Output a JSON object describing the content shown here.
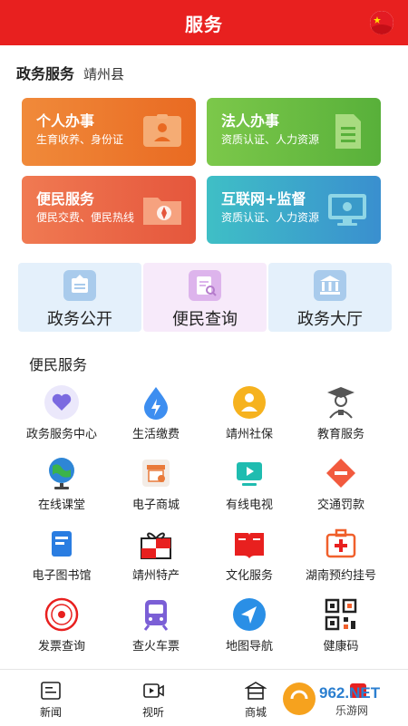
{
  "header": {
    "title": "服务",
    "flag_icon": "china-flag-icon"
  },
  "section": {
    "title": "政务服务",
    "location": "靖州县"
  },
  "cards": [
    {
      "title": "个人办事",
      "subtitle": "生育收养、身份证",
      "icon": "id-card-icon",
      "color": "#ec7a2e"
    },
    {
      "title": "法人办事",
      "subtitle": "资质认证、人力资源",
      "icon": "document-icon",
      "color": "#68bb42"
    },
    {
      "title": "便民服务",
      "subtitle": "便民交费、便民热线",
      "icon": "folder-compass-icon",
      "color": "#ea6646"
    },
    {
      "title": "互联网+监督",
      "subtitle": "资质认证、人力资源",
      "icon": "monitor-icon",
      "color": "#3ea8ca"
    }
  ],
  "quick": [
    {
      "label": "政务公开",
      "icon": "bulletin-icon"
    },
    {
      "label": "便民查询",
      "icon": "search-doc-icon"
    },
    {
      "label": "政务大厅",
      "icon": "hall-icon"
    }
  ],
  "grid": {
    "title": "便民服务",
    "items": [
      {
        "label": "政务服务中心",
        "icon": "heart-chat-icon"
      },
      {
        "label": "生活缴费",
        "icon": "water-drop-icon"
      },
      {
        "label": "靖州社保",
        "icon": "social-security-icon"
      },
      {
        "label": "教育服务",
        "icon": "graduate-icon"
      },
      {
        "label": "在线课堂",
        "icon": "globe-icon"
      },
      {
        "label": "电子商城",
        "icon": "shop-icon"
      },
      {
        "label": "有线电视",
        "icon": "tv-play-icon"
      },
      {
        "label": "交通罚款",
        "icon": "no-entry-icon"
      },
      {
        "label": "电子图书馆",
        "icon": "ebook-icon"
      },
      {
        "label": "靖州特产",
        "icon": "gift-icon"
      },
      {
        "label": "文化服务",
        "icon": "open-book-icon"
      },
      {
        "label": "湖南预约挂号",
        "icon": "medical-case-icon"
      },
      {
        "label": "发票查询",
        "icon": "seal-icon"
      },
      {
        "label": "查火车票",
        "icon": "train-icon"
      },
      {
        "label": "地图导航",
        "icon": "navigation-icon"
      },
      {
        "label": "健康码",
        "icon": "qr-code-icon"
      }
    ]
  },
  "tabs": [
    {
      "label": "新闻",
      "icon": "news-icon"
    },
    {
      "label": "视听",
      "icon": "video-icon"
    },
    {
      "label": "商城",
      "icon": "store-icon"
    },
    {
      "label": "",
      "icon": "service-icon"
    }
  ],
  "watermark": {
    "brand": "962.NET",
    "sub": "乐游网"
  }
}
